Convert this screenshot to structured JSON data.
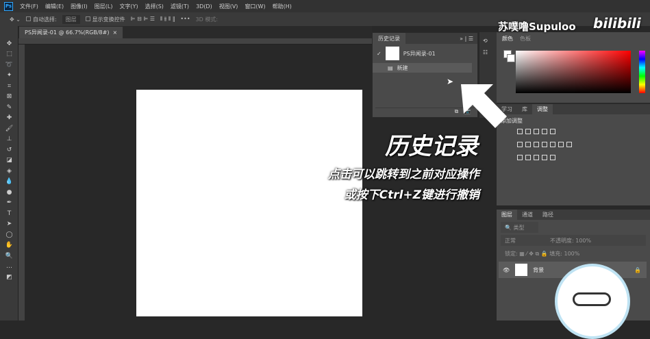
{
  "menubar": {
    "items": [
      "文件(F)",
      "编辑(E)",
      "图像(I)",
      "图层(L)",
      "文字(Y)",
      "选择(S)",
      "滤镜(T)",
      "3D(D)",
      "视图(V)",
      "窗口(W)",
      "帮助(H)"
    ]
  },
  "options": {
    "auto_select": "自动选择:",
    "layer_select": "图层",
    "show_transform": "显示变换控件",
    "mode_3d": "3D 模式:"
  },
  "document": {
    "tab_title": "PS异闻录-01 @ 66.7%(RGB/8#)",
    "close": "×"
  },
  "history": {
    "title": "历史记录",
    "items": [
      "PS异闻录-01",
      "新建"
    ]
  },
  "color_panel": {
    "tabs": [
      "颜色",
      "色板"
    ]
  },
  "adjust_panel": {
    "tabs": [
      "学习",
      "库",
      "调整"
    ],
    "add_label": "添加调整"
  },
  "layers_panel": {
    "tabs": [
      "图层",
      "通道",
      "路径"
    ],
    "filter": "类型",
    "blend": "正常",
    "opacity_label": "不透明度:",
    "opacity": "100%",
    "lock_label": "锁定:",
    "fill_label": "填充:",
    "fill": "100%",
    "layer_name": "背景"
  },
  "overlay": {
    "title": "历史记录",
    "line1": "点击可以跳转到之前对应操作",
    "line2": "或按下Ctrl+Z键进行撤销"
  },
  "watermark": {
    "author": "苏噗噜Supuloo",
    "logo": "bilibili"
  }
}
